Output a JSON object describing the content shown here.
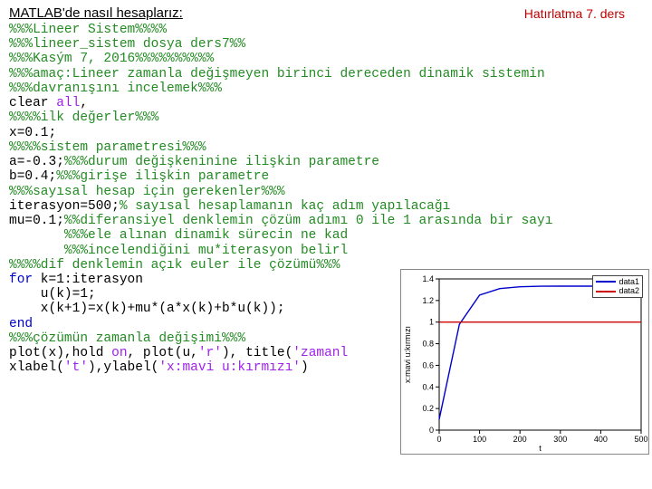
{
  "header": {
    "title": "MATLAB'de nasıl hesaplarız:",
    "reminder": "Hatırlatma 7. ders"
  },
  "code": {
    "l01": "%%%Lineer Sistem%%%%",
    "l02": "%%%lineer_sistem dosya ders7%%",
    "l03": "%%%Kasým 7, 2016%%%%%%%%%%",
    "l04": "%%%amaç:Lineer zamanla değişmeyen birinci dereceden dinamik sistemin",
    "l05": "%%%davranışını incelemek%%%",
    "l06a": "clear ",
    "l06b": "all",
    "l06c": ",",
    "l07": "%%%%ilk değerler%%%",
    "l08": "x=0.1;",
    "l09": "%%%%sistem parametresi%%%",
    "l10a": "a=-0.3;",
    "l10b": "%%%durum değişkeninine ilişkin parametre",
    "l11a": "b=0.4;",
    "l11b": "%%%girişe ilişkin parametre",
    "l12": "%%%sayısal hesap için gerekenler%%%",
    "l13a": "iterasyon=500;",
    "l13b": "% sayısal hesaplamanın kaç adım yapılacağı",
    "l14a": "mu=0.1;",
    "l14b": "%%diferansiyel denklemin çözüm adımı 0 ile 1 arasında bir sayı",
    "l15": "       %%%ele alınan dinamik sürecin ne kad",
    "l16": "       %%%incelendiğini mu*iterasyon belirl",
    "l17": "%%%%dif denklemin açık euler ile çözümü%%%",
    "l18a": "for",
    "l18b": " k=1:iterasyon",
    "l19": "    u(k)=1;",
    "l20": "    x(k+1)=x(k)+mu*(a*x(k)+b*u(k));",
    "l21": "end",
    "l22": "%%%çözümün zamanla değişimi%%%",
    "l23a": "plot(x),hold ",
    "l23b": "on",
    "l23c": ", plot(u,",
    "l23d": "'r'",
    "l23e": "), title(",
    "l23f": "'zamanl",
    "l24a": "xlabel(",
    "l24b": "'t'",
    "l24c": "),ylabel(",
    "l24d": "'x:mavi u:kırmızı'",
    "l24e": ")"
  },
  "chart_data": {
    "type": "line",
    "x": [
      0,
      50,
      100,
      150,
      200,
      250,
      300,
      350,
      400,
      450,
      500
    ],
    "series": [
      {
        "name": "data1",
        "color": "#0000cd",
        "values": [
          0.1,
          0.98,
          1.25,
          1.31,
          1.327,
          1.332,
          1.333,
          1.333,
          1.333,
          1.333,
          1.333
        ]
      },
      {
        "name": "data2",
        "color": "#cc0000",
        "values": [
          1,
          1,
          1,
          1,
          1,
          1,
          1,
          1,
          1,
          1,
          1
        ]
      }
    ],
    "xlabel": "t",
    "ylabel": "x:mavi u:kırmızı",
    "xlim": [
      0,
      500
    ],
    "ylim": [
      0,
      1.4
    ],
    "xticks": [
      0,
      100,
      200,
      300,
      400,
      500
    ],
    "yticks": [
      0,
      0.2,
      0.4,
      0.6,
      0.8,
      1.0,
      1.2,
      1.4
    ],
    "legend": [
      "data1",
      "data2"
    ]
  }
}
